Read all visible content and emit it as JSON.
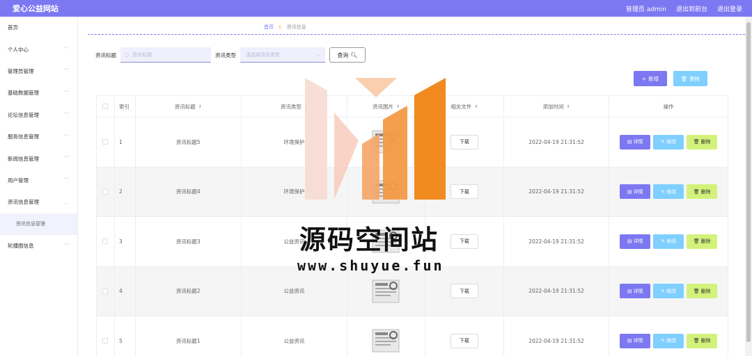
{
  "header": {
    "brand": "爱心公益网站",
    "user_label": "管理员 admin",
    "back_front": "退出到前台",
    "logout": "退出登录"
  },
  "sidebar": {
    "items": [
      {
        "label": "首页",
        "has_chevron": false
      },
      {
        "label": "个人中心",
        "has_chevron": true
      },
      {
        "label": "管理员管理",
        "has_chevron": true
      },
      {
        "label": "基础数据管理",
        "has_chevron": true
      },
      {
        "label": "论坛信息管理",
        "has_chevron": true
      },
      {
        "label": "服务信息管理",
        "has_chevron": true
      },
      {
        "label": "新闻信息管理",
        "has_chevron": true
      },
      {
        "label": "用户管理",
        "has_chevron": true
      },
      {
        "label": "资讯信息管理",
        "has_chevron": true
      },
      {
        "label": "资讯信息管理",
        "sub": true
      },
      {
        "label": "轮播图信息",
        "has_chevron": true
      }
    ]
  },
  "breadcrumb": {
    "home": "首页",
    "current": "资讯信息"
  },
  "search": {
    "title_label": "资讯标题",
    "title_placeholder": "资讯标题",
    "type_label": "资讯类型",
    "type_placeholder": "请选择资讯类型",
    "query_button": "查询"
  },
  "actions": {
    "add": "新增",
    "delete": "删除"
  },
  "table": {
    "headers": [
      "索引",
      "资讯标题",
      "资讯类型",
      "资讯图片",
      "相关文件",
      "添加时间",
      "操作"
    ],
    "rows": [
      {
        "index": "1",
        "title": "资讯标题5",
        "type": "环境保护",
        "download": "下载",
        "time": "2022-04-19 21:31:52"
      },
      {
        "index": "2",
        "title": "资讯标题4",
        "type": "环境保护",
        "download": "下载",
        "time": "2022-04-19 21:31:52"
      },
      {
        "index": "3",
        "title": "资讯标题3",
        "type": "公益资讯",
        "download": "下载",
        "time": "2022-04-19 21:31:52"
      },
      {
        "index": "4",
        "title": "资讯标题2",
        "type": "公益资讯",
        "download": "下载",
        "time": "2022-04-19 21:31:52"
      },
      {
        "index": "5",
        "title": "资讯标题1",
        "type": "公益资讯",
        "download": "下载",
        "time": "2022-04-19 21:31:52"
      }
    ],
    "ops": {
      "detail": "详情",
      "edit": "修改",
      "delete": "删除"
    }
  },
  "watermark": {
    "title": "源码空间站",
    "url": "www.shuyue.fun"
  },
  "colors": {
    "primary": "#7c78f2",
    "info": "#7fcfff",
    "lime": "#d3f27b"
  }
}
